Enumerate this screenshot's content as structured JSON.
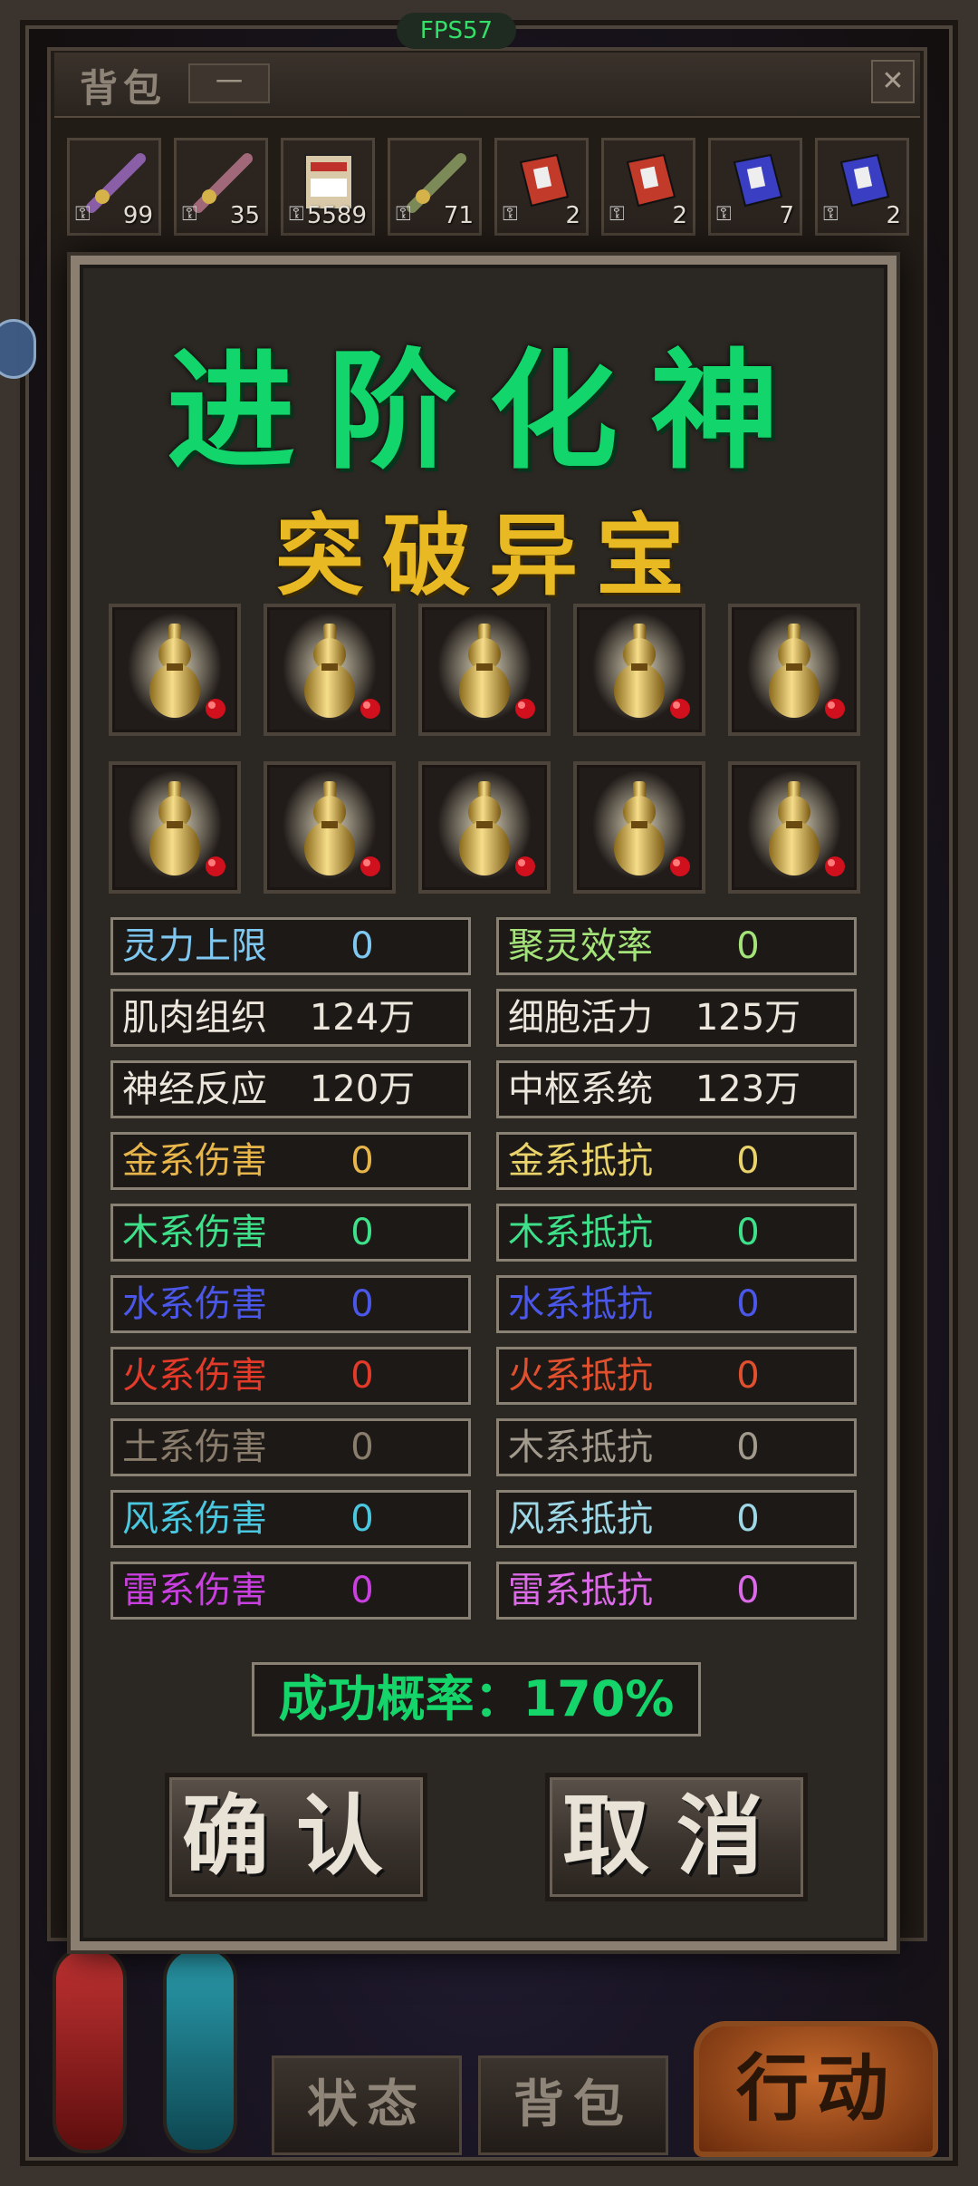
{
  "hud": {
    "fps": "FPS57"
  },
  "bag_window": {
    "title": "背包",
    "minimize": "一",
    "close": "✕",
    "items": [
      {
        "count": "99",
        "icon": "weapon-icon",
        "color": "#8a5fa8"
      },
      {
        "count": "35",
        "icon": "weapon-icon",
        "color": "#a06878"
      },
      {
        "count": "5589",
        "icon": "scroll-icon",
        "color": "#d9c9a8"
      },
      {
        "count": "71",
        "icon": "weapon-icon",
        "color": "#7c8a58"
      },
      {
        "count": "2",
        "icon": "book-icon",
        "color": "#c23a2a"
      },
      {
        "count": "2",
        "icon": "book-icon",
        "color": "#c23a2a"
      },
      {
        "count": "7",
        "icon": "book-icon",
        "color": "#3a3ec2"
      },
      {
        "count": "2",
        "icon": "book-icon",
        "color": "#3a3ec2"
      }
    ]
  },
  "dialog": {
    "title": "进阶化神",
    "subtitle": "突破异宝",
    "treasures": [
      "gourd-icon",
      "gourd-icon",
      "gourd-icon",
      "gourd-icon",
      "gourd-icon",
      "gourd-icon",
      "gourd-icon",
      "gourd-icon",
      "gourd-icon",
      "gourd-icon"
    ],
    "stats_left": [
      {
        "label": "灵力上限",
        "value": "0",
        "color": "#7fc8f2"
      },
      {
        "label": "肌肉组织",
        "value": "124万",
        "color": "#ece6dc"
      },
      {
        "label": "神经反应",
        "value": "120万",
        "color": "#ece6dc"
      },
      {
        "label": "金系伤害",
        "value": "0",
        "color": "#e7b54a"
      },
      {
        "label": "木系伤害",
        "value": "0",
        "color": "#3ee08a"
      },
      {
        "label": "水系伤害",
        "value": "0",
        "color": "#4b57e8"
      },
      {
        "label": "火系伤害",
        "value": "0",
        "color": "#e43a2a"
      },
      {
        "label": "土系伤害",
        "value": "0",
        "color": "#8a7d6c"
      },
      {
        "label": "风系伤害",
        "value": "0",
        "color": "#4ac8e0"
      },
      {
        "label": "雷系伤害",
        "value": "0",
        "color": "#c93fe0"
      }
    ],
    "stats_right": [
      {
        "label": "聚灵效率",
        "value": "0",
        "color": "#a4e27a"
      },
      {
        "label": "细胞活力",
        "value": "125万",
        "color": "#ece6dc"
      },
      {
        "label": "中枢系统",
        "value": "123万",
        "color": "#ece6dc"
      },
      {
        "label": "金系抵抗",
        "value": "0",
        "color": "#e9d36a"
      },
      {
        "label": "木系抵抗",
        "value": "0",
        "color": "#3ee08a"
      },
      {
        "label": "水系抵抗",
        "value": "0",
        "color": "#4b57e8"
      },
      {
        "label": "火系抵抗",
        "value": "0",
        "color": "#e0502e"
      },
      {
        "label": "木系抵抗",
        "value": "0",
        "color": "#a39a8e"
      },
      {
        "label": "风系抵抗",
        "value": "0",
        "color": "#9ed8e6"
      },
      {
        "label": "雷系抵抗",
        "value": "0",
        "color": "#dc6ae8"
      }
    ],
    "success_rate": "成功概率：170%",
    "confirm": "确认",
    "cancel": "取消"
  },
  "bottom": {
    "tab_status": "状态",
    "tab_bag": "背包",
    "action": "行动"
  }
}
